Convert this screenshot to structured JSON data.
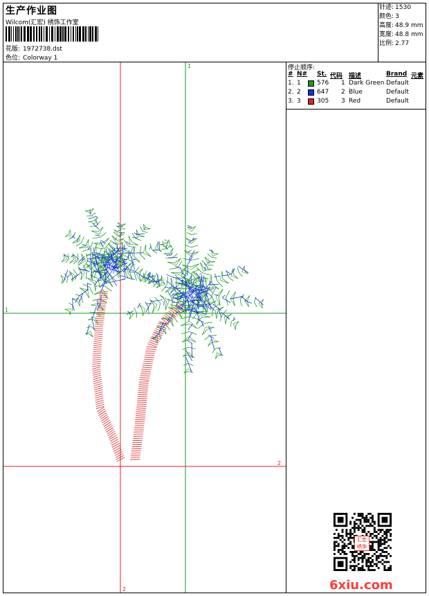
{
  "header": {
    "title": "生产作业图",
    "company": "Wilcom(汇宏) 绣饰工作室",
    "pattern_label": "花版:",
    "pattern_value": "1972738.dst",
    "colorway_label": "色位:",
    "colorway_value": "Colorway 1"
  },
  "stats": [
    {
      "label": "针迹:",
      "value": "1530"
    },
    {
      "label": "颜色:",
      "value": "3"
    },
    {
      "label": "高度:",
      "value": "48.9 mm"
    },
    {
      "label": "宽度:",
      "value": "48.8 mm"
    },
    {
      "label": "比例:",
      "value": "2.77"
    }
  ],
  "stops": {
    "title": "停止顺序:",
    "columns": [
      "#",
      "N#",
      "St.",
      "代码",
      "描述",
      "Brand",
      "元素"
    ],
    "rows": [
      {
        "index": "1.",
        "n": "1",
        "color": "#1a9a1a",
        "st": "576",
        "code": "1",
        "desc": "Dark Green",
        "brand": "Default"
      },
      {
        "index": "2.",
        "n": "2",
        "color": "#1030e0",
        "st": "647",
        "code": "2",
        "desc": "Blue",
        "brand": "Default"
      },
      {
        "index": "3.",
        "n": "3",
        "color": "#e02020",
        "st": "305",
        "code": "3",
        "desc": "Red",
        "brand": "Default"
      }
    ]
  },
  "design": {
    "axis_labels": {
      "v_green_top": "1",
      "h_green_left": "1",
      "h_red_right": "2",
      "v_red_bottom": "2"
    },
    "colors": {
      "green": "#1a9a1a",
      "blue": "#1030e0",
      "red": "#e02020"
    }
  },
  "branding": {
    "stamp": "汇宏 绣饰",
    "watermark": "6xiu.com"
  }
}
